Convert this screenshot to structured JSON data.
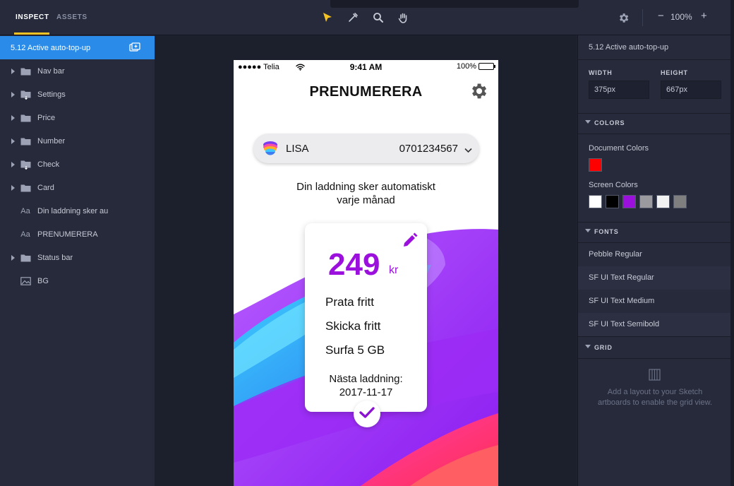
{
  "topbar": {
    "tab_inspect": "INSPECT",
    "tab_assets": "ASSETS",
    "zoom_minus": "−",
    "zoom_level": "100%",
    "zoom_plus": "+"
  },
  "layers": {
    "selected": "5.12 Active auto-top-up",
    "items": [
      {
        "label": "Nav bar",
        "type": "folder"
      },
      {
        "label": "Settings",
        "type": "folder-symbol"
      },
      {
        "label": "Price",
        "type": "folder"
      },
      {
        "label": "Number",
        "type": "folder"
      },
      {
        "label": "Check",
        "type": "folder-symbol"
      },
      {
        "label": "Card",
        "type": "folder"
      },
      {
        "label": "Din laddning sker au",
        "type": "text"
      },
      {
        "label": "PRENUMERERA",
        "type": "text"
      },
      {
        "label": "Status bar",
        "type": "folder"
      },
      {
        "label": "BG",
        "type": "image"
      }
    ]
  },
  "artboard": {
    "status": {
      "carrier": "●●●●● Telia",
      "time": "9:41 AM",
      "battery": "100%"
    },
    "title": "PRENUMERERA",
    "selector": {
      "name": "LISA",
      "number": "0701234567"
    },
    "description_line1": "Din laddning sker automatiskt",
    "description_line2": "varje månad",
    "card": {
      "price": "249",
      "unit": "kr",
      "features": [
        "Prata fritt",
        "Skicka fritt",
        "Surfa 5 GB"
      ],
      "next_label": "Nästa laddning:",
      "next_date": "2017-11-17"
    },
    "colors": {
      "accent": "#9b10dd"
    }
  },
  "inspector": {
    "title": "5.12 Active auto-top-up",
    "width_label": "WIDTH",
    "width_value": "375px",
    "height_label": "HEIGHT",
    "height_value": "667px",
    "colors_label": "COLORS",
    "document_colors_label": "Document Colors",
    "document_colors": [
      "#ff0000"
    ],
    "screen_colors_label": "Screen Colors",
    "screen_colors": [
      "#ffffff",
      "#000000",
      "#9b10dd",
      "#9a9a9f",
      "#f2f2f2",
      "#7f7f7f"
    ],
    "fonts_label": "FONTS",
    "fonts": [
      "Pebble Regular",
      "SF UI Text Regular",
      "SF UI Text Medium",
      "SF UI Text Semibold"
    ],
    "grid_label": "GRID",
    "grid_hint_line1": "Add a layout to your Sketch",
    "grid_hint_line2": "artboards to enable the grid view."
  }
}
